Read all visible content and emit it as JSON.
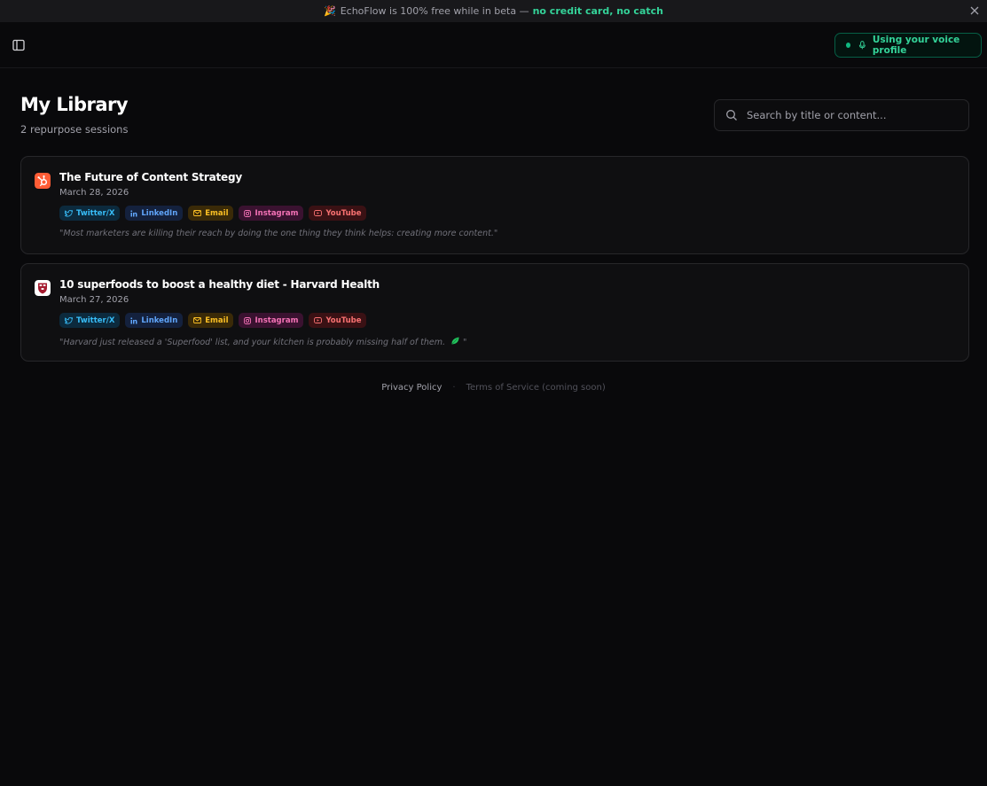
{
  "banner": {
    "icon": "party-popper-icon",
    "text": "EchoFlow is 100% free while in beta —",
    "highlight": "no credit card, no catch"
  },
  "header": {
    "voice_profile_label": "Using your voice profile"
  },
  "library": {
    "title": "My Library",
    "subtitle": "2 repurpose sessions"
  },
  "search": {
    "placeholder": "Search by title or content...",
    "value": ""
  },
  "sessions": [
    {
      "favicon": "hubspot-icon",
      "title": "The Future of Content Strategy",
      "date": "March 28, 2026",
      "tags": [
        "Twitter/X",
        "LinkedIn",
        "Email",
        "Instagram",
        "YouTube"
      ],
      "quote": "\"Most marketers are killing their reach by doing the one thing they think helps: creating more content.\""
    },
    {
      "favicon": "harvard-shield-icon",
      "title": "10 superfoods to boost a healthy diet - Harvard Health",
      "date": "March 27, 2026",
      "tags": [
        "Twitter/X",
        "LinkedIn",
        "Email",
        "Instagram",
        "YouTube"
      ],
      "quote": "\"Harvard just released a 'Superfood' list, and your kitchen is probably missing half of them.",
      "quote_end": "\""
    }
  ],
  "footer": {
    "privacy": "Privacy Policy",
    "separator": "·",
    "terms": "Terms of Service (coming soon)"
  },
  "colors": {
    "accent": "#34d399",
    "background": "#09090b",
    "card": "#0f0f11"
  }
}
